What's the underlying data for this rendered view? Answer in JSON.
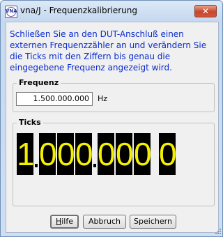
{
  "window": {
    "title": "vna/J - Frequenzkalibrierung",
    "app_icon_text": "VNA",
    "close_symbol": "✕"
  },
  "instructions": "Schließen Sie an den DUT-Anschluß einen externen Frequenzzähler an und verändern Sie die Ticks mit den Ziffern bis genau die eingegebene Frequenz angezeigt wird.",
  "frequency": {
    "label": "Frequenz",
    "value": "1.500.000.000",
    "unit": "Hz"
  },
  "ticks": {
    "label": "Ticks",
    "digits": [
      "1",
      "0",
      "0",
      "0",
      "0",
      "0",
      "0",
      "0"
    ]
  },
  "buttons": {
    "help_mnemonic": "H",
    "help_rest": "ilfe",
    "cancel": "Abbruch",
    "save": "Speichern"
  },
  "colors": {
    "instruction_text": "#0a2bcf",
    "digit_background": "#000000",
    "digit_foreground": "#f5f000"
  }
}
